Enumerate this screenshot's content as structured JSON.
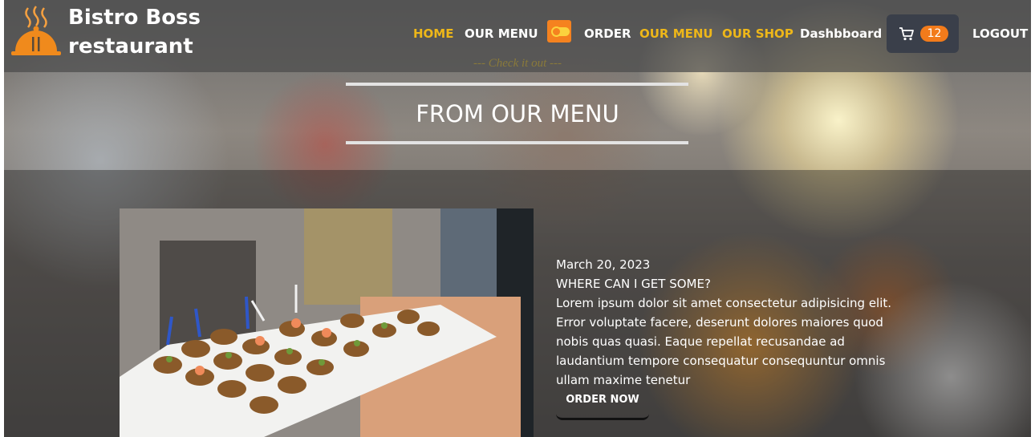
{
  "brand": {
    "line1": "Bistro Boss",
    "line2": "restaurant"
  },
  "nav": {
    "home": "HOME",
    "our_menu": "OUR MENU",
    "order": "ORDER",
    "our_menu_2": "OUR MENU",
    "our_shop": "OUR SHOP",
    "dashboard": "Dashbboard",
    "logout": "LOGOUT",
    "cart_count": "12"
  },
  "section": {
    "subheading": "--- Check it out ---",
    "title": "FROM OUR MENU"
  },
  "feature": {
    "date": "March 20, 2023",
    "heading": "WHERE CAN I GET SOME?",
    "body": "Lorem ipsum dolor sit amet consectetur adipisicing elit. Error voluptate facere, deserunt dolores maiores quod nobis quas quasi. Eaque repellat recusandae ad laudantium tempore consequatur consequuntur omnis ullam maxime tenetur",
    "button": "ORDER NOW"
  },
  "colors": {
    "accent": "#eeb719",
    "badge": "#f27b1b",
    "cart_button": "#3a3f4a"
  },
  "icons": {
    "logo": "cloche-icon",
    "theme": "toggle-icon",
    "cart": "cart-icon"
  }
}
